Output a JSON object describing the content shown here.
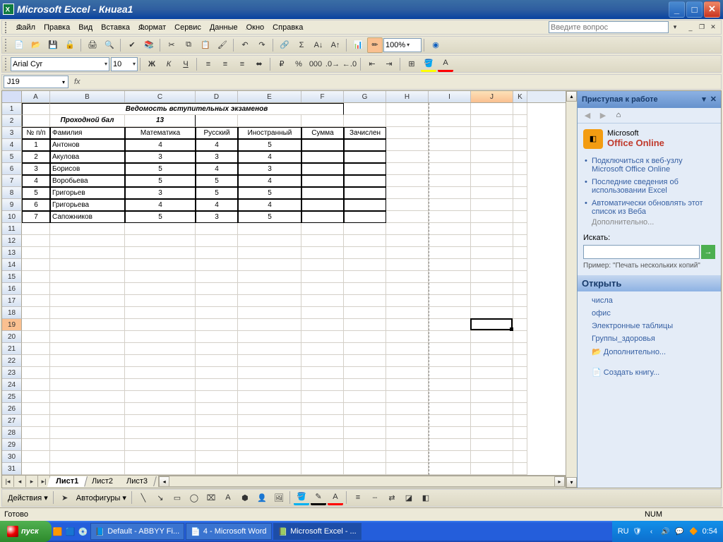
{
  "titlebar": {
    "title": "Microsoft Excel - Книга1"
  },
  "menu": {
    "items": [
      "Файл",
      "Правка",
      "Вид",
      "Вставка",
      "Формат",
      "Сервис",
      "Данные",
      "Окно",
      "Справка"
    ],
    "helpbox_placeholder": "Введите вопрос"
  },
  "fmt": {
    "font": "Arial Cyr",
    "size": "10"
  },
  "stdtoolbar": {
    "zoom": "100%"
  },
  "namebox": "J19",
  "columns": [
    "A",
    "B",
    "C",
    "D",
    "E",
    "F",
    "G",
    "H",
    "I",
    "J",
    "K"
  ],
  "grid": {
    "title": "Ведомость вступительных экзаменов",
    "pass_label": "Проходной бал",
    "pass_value": "13",
    "headers": [
      "№ п/п",
      "Фамилия",
      "Математика",
      "Русский",
      "Иностранный",
      "Сумма",
      "Зачислен"
    ],
    "rows": [
      {
        "n": "1",
        "name": "Антонов",
        "math": "4",
        "rus": "4",
        "lang": "5"
      },
      {
        "n": "2",
        "name": "Акулова",
        "math": "3",
        "rus": "3",
        "lang": "4"
      },
      {
        "n": "3",
        "name": "Борисов",
        "math": "5",
        "rus": "4",
        "lang": "3"
      },
      {
        "n": "4",
        "name": "Воробьева",
        "math": "5",
        "rus": "5",
        "lang": "4"
      },
      {
        "n": "5",
        "name": "Григорьев",
        "math": "3",
        "rus": "5",
        "lang": "5"
      },
      {
        "n": "6",
        "name": "Григорьева",
        "math": "4",
        "rus": "4",
        "lang": "4"
      },
      {
        "n": "7",
        "name": "Сапожников",
        "math": "5",
        "rus": "3",
        "lang": "5"
      }
    ]
  },
  "sheets": [
    "Лист1",
    "Лист2",
    "Лист3"
  ],
  "taskpane": {
    "title": "Приступая к работе",
    "office_online": "Office Online",
    "ms_label": "Microsoft",
    "links": [
      "Подключиться к веб-узлу Microsoft Office Online",
      "Последние сведения об использовании Excel",
      "Автоматически обновлять этот список из Веба"
    ],
    "more": "Дополнительно...",
    "search_label": "Искать:",
    "example": "Пример: \"Печать нескольких копий\"",
    "open_title": "Открыть",
    "recent": [
      "числа",
      "офис",
      "Электронные таблицы",
      "Группы_здоровья"
    ],
    "open_more": "Дополнительно...",
    "create": "Создать книгу..."
  },
  "drawbar": {
    "actions": "Действия",
    "autoshapes": "Автофигуры"
  },
  "status": {
    "ready": "Готово",
    "num": "NUM"
  },
  "taskbar": {
    "start": "пуск",
    "items": [
      "Default - ABBYY Fi...",
      "4 - Microsoft Word",
      "Microsoft Excel - ..."
    ],
    "lang": "RU",
    "time": "0:54"
  }
}
